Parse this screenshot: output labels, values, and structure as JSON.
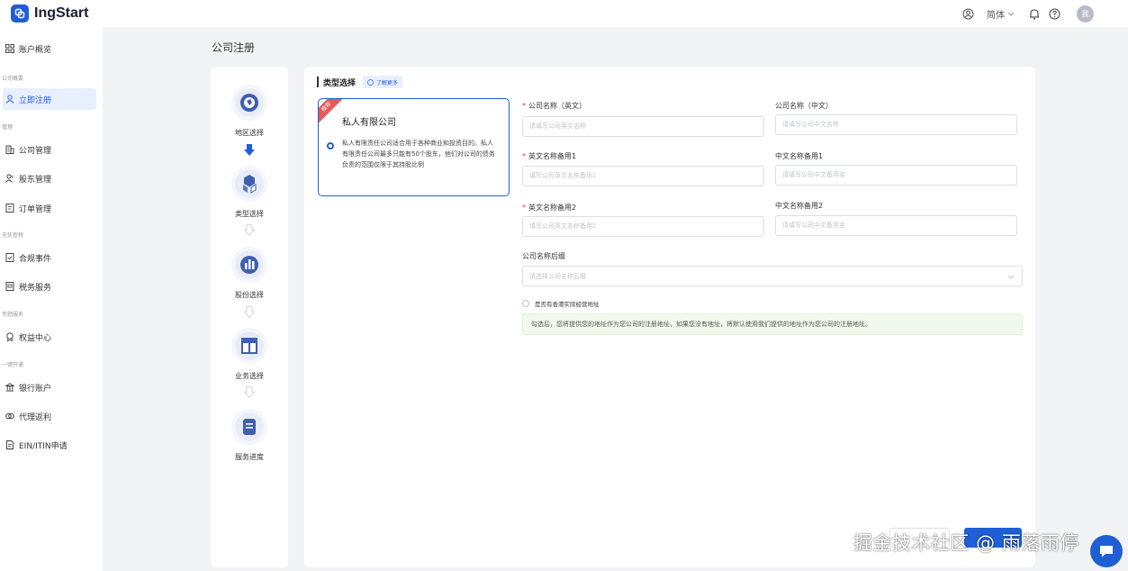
{
  "app": {
    "name": "IngStart",
    "brand_color": "#1f5fd6"
  },
  "header": {
    "lang_label": "简体",
    "avatar_text": "我"
  },
  "sidebar": {
    "items": [
      {
        "label": "账户概览",
        "icon": "grid-icon"
      },
      {
        "group": "公司概要"
      },
      {
        "label": "立即注册",
        "icon": "user-icon",
        "active": true
      },
      {
        "group": "管理"
      },
      {
        "label": "公司管理",
        "icon": "building-icon"
      },
      {
        "label": "股东管理",
        "icon": "shareholder-icon"
      },
      {
        "label": "订单管理",
        "icon": "order-icon"
      },
      {
        "group": "无忧查税"
      },
      {
        "label": "合规事件",
        "icon": "compliance-icon"
      },
      {
        "label": "税务服务",
        "icon": "tax-icon"
      },
      {
        "group": "专题服务"
      },
      {
        "label": "权益中心",
        "icon": "badge-icon"
      },
      {
        "group": "一键开通"
      },
      {
        "label": "银行账户",
        "icon": "bank-icon"
      },
      {
        "label": "代理返利",
        "icon": "rebate-icon"
      },
      {
        "label": "EIN/ITIN申请",
        "icon": "document-icon"
      }
    ]
  },
  "page": {
    "title": "公司注册"
  },
  "steps": [
    {
      "label": "地区选择",
      "icon": "globe-icon",
      "done": true
    },
    {
      "label": "类型选择",
      "icon": "cubes-icon",
      "current": true
    },
    {
      "label": "股份选择",
      "icon": "bar-chart-icon"
    },
    {
      "label": "业务选择",
      "icon": "layout-icon"
    },
    {
      "label": "服务进度",
      "icon": "clipboard-icon"
    }
  ],
  "section": {
    "title": "类型选择",
    "learn_more": "了解更多"
  },
  "type_card": {
    "ribbon": "推荐",
    "title": "私人有限公司",
    "description": "私人有限责任公司适合用于各种商业和投资目的。私人有限责任公司最多只能有50个股东，他们对公司的债务负责的范围仅限于其持股比例"
  },
  "form": {
    "name_en": {
      "label": "公司名称（英文）",
      "placeholder": "请填写公司英文名称"
    },
    "name_cn": {
      "label": "公司名称（中文）",
      "placeholder": "请填写公司中文名称"
    },
    "alt_en_1": {
      "label": "英文名称备用1",
      "placeholder": "填写公司英文名称备用1"
    },
    "alt_cn_1": {
      "label": "中文名称备用1",
      "placeholder": "请填写公司中文备用名"
    },
    "alt_en_2": {
      "label": "英文名称备用2",
      "placeholder": "填写公司英文名称备用2"
    },
    "alt_cn_2": {
      "label": "中文名称备用2",
      "placeholder": "请填写公司中文备用名"
    },
    "suffix": {
      "label": "公司名称后缀",
      "placeholder": "请选择公司名称后缀"
    },
    "hk_address_label": "是否有香港实际经营地址",
    "tip": "勾选后，您将提供您的地址作为您公司的注册地址，如果您没有地址，将默认使用我们提供的地址作为您公司的注册地址。"
  },
  "watermark": "掘金技术社区 @ 雨落雨停"
}
